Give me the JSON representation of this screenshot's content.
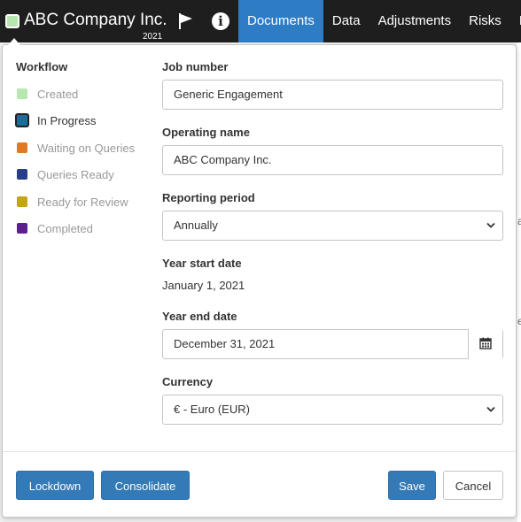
{
  "header": {
    "company": "ABC Company Inc.",
    "year": "2021",
    "status_color": "#b8e6b0",
    "icons": [
      "flag-icon",
      "info-icon"
    ],
    "info_glyph": "i",
    "tabs": [
      {
        "label": "Documents",
        "active": true
      },
      {
        "label": "Data",
        "active": false
      },
      {
        "label": "Adjustments",
        "active": false
      },
      {
        "label": "Risks",
        "active": false
      },
      {
        "label": "Issu",
        "active": false
      }
    ]
  },
  "background": {
    "peek_text_1": "a",
    "peek_text_2": "e"
  },
  "workflow": {
    "title": "Workflow",
    "items": [
      {
        "label": "Created",
        "color": "#b8e6b0"
      },
      {
        "label": "In Progress",
        "color": "#1a6e99",
        "current": true
      },
      {
        "label": "Waiting on Queries",
        "color": "#e07b25"
      },
      {
        "label": "Queries Ready",
        "color": "#263e8c"
      },
      {
        "label": "Ready for Review",
        "color": "#c4a512"
      },
      {
        "label": "Completed",
        "color": "#5c1f91"
      }
    ]
  },
  "form": {
    "job_number": {
      "label": "Job number",
      "value": "Generic Engagement"
    },
    "operating_name": {
      "label": "Operating name",
      "value": "ABC Company Inc."
    },
    "reporting_period": {
      "label": "Reporting period",
      "value": "Annually"
    },
    "year_start": {
      "label": "Year start date",
      "value": "January 1, 2021"
    },
    "year_end": {
      "label": "Year end date",
      "value": "December 31, 2021",
      "icon": "calendar-icon"
    },
    "currency": {
      "label": "Currency",
      "value": "€ - Euro (EUR)"
    }
  },
  "footer": {
    "lockdown": "Lockdown",
    "consolidate": "Consolidate",
    "save": "Save",
    "cancel": "Cancel"
  },
  "colors": {
    "primary": "#337ab7",
    "topbar": "#1e1e1e",
    "active_tab": "#2e7cc4"
  }
}
